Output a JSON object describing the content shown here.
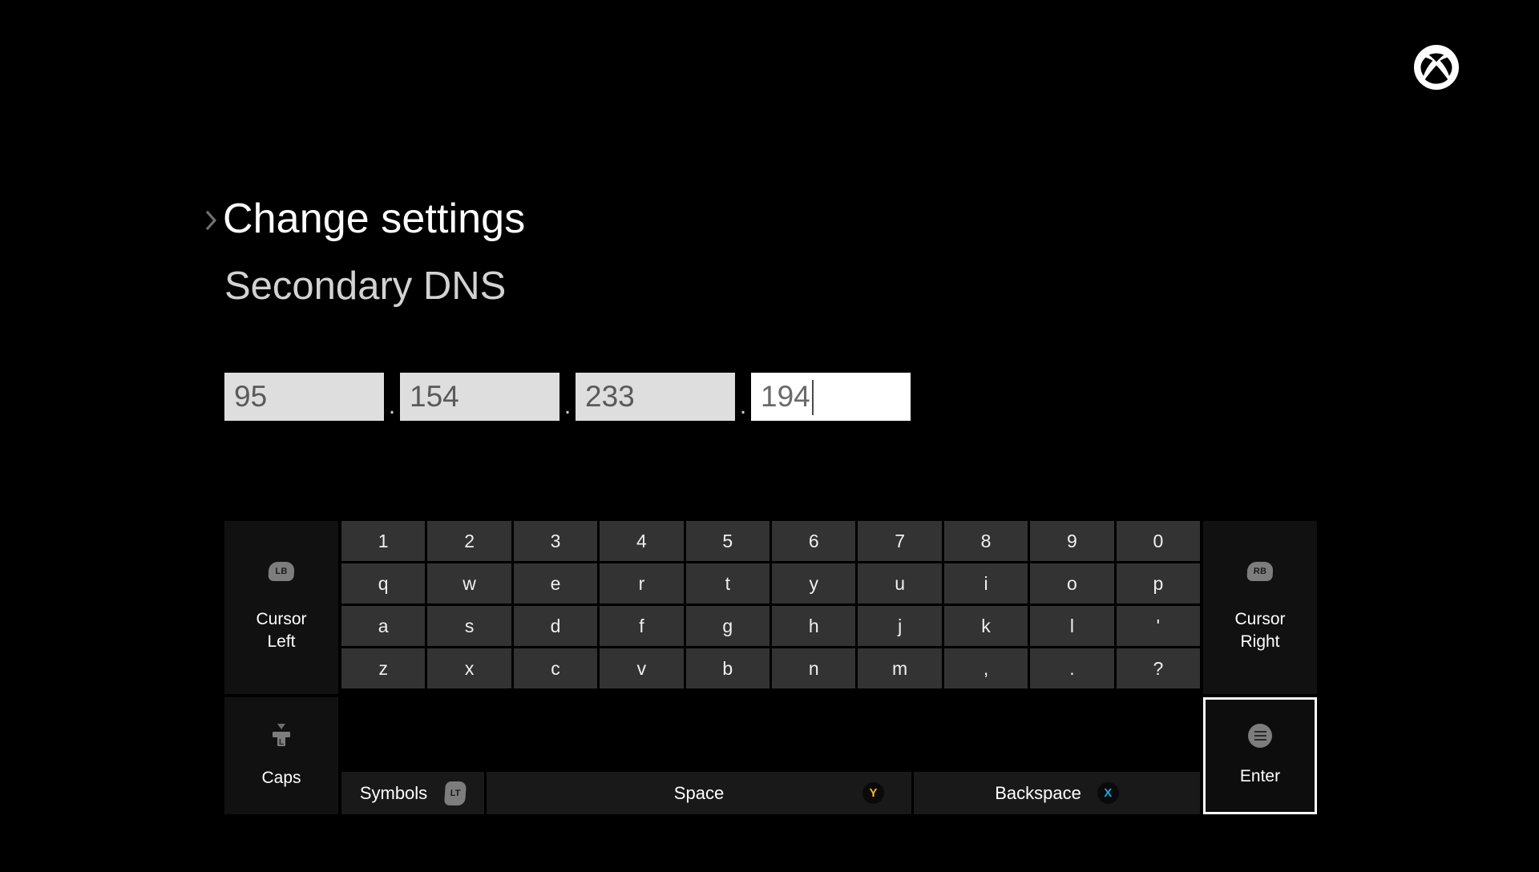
{
  "screen": {
    "background_color": "#000000",
    "platform_logo": "xbox-logo"
  },
  "header": {
    "breadcrumb_icon": "chevron-right-icon",
    "breadcrumb": "Change settings",
    "subtitle": "Secondary DNS"
  },
  "ip_input": {
    "separator": ".",
    "octets": [
      {
        "value": "95",
        "focused": false
      },
      {
        "value": "154",
        "focused": false
      },
      {
        "value": "233",
        "focused": false
      },
      {
        "value": "194",
        "focused": true
      }
    ],
    "field_bg": "#dedede",
    "focused_field_bg": "#ffffff",
    "text_color": "#5a5a5a"
  },
  "keyboard": {
    "key_bg": "#333333",
    "panel_bg": "#111111",
    "focus_border_color": "#ffffff",
    "rows": [
      [
        "1",
        "2",
        "3",
        "4",
        "5",
        "6",
        "7",
        "8",
        "9",
        "0"
      ],
      [
        "q",
        "w",
        "e",
        "r",
        "t",
        "y",
        "u",
        "i",
        "o",
        "p"
      ],
      [
        "a",
        "s",
        "d",
        "f",
        "g",
        "h",
        "j",
        "k",
        "l",
        "'"
      ],
      [
        "z",
        "x",
        "c",
        "v",
        "b",
        "n",
        "m",
        ",",
        ".",
        "?"
      ]
    ],
    "panels": {
      "cursor_left": {
        "label_line1": "Cursor",
        "label_line2": "Left",
        "badge": "LB",
        "badge_icon": "left-bumper-icon"
      },
      "cursor_right": {
        "label_line1": "Cursor",
        "label_line2": "Right",
        "badge": "RB",
        "badge_icon": "right-bumper-icon"
      },
      "caps": {
        "label": "Caps",
        "badge": "LT",
        "badge_icon": "left-trigger-icon"
      },
      "enter": {
        "label": "Enter",
        "badge_icon": "menu-button-icon",
        "focused": true
      }
    },
    "actions": {
      "symbols": {
        "label": "Symbols",
        "badge": "LT",
        "badge_icon": "left-trigger-icon"
      },
      "space": {
        "label": "Space",
        "badge": "Y",
        "badge_icon": "y-button-icon",
        "badge_color": "#f5b81c"
      },
      "backspace": {
        "label": "Backspace",
        "badge": "X",
        "badge_icon": "x-button-icon",
        "badge_color": "#1fa5e0"
      }
    }
  }
}
